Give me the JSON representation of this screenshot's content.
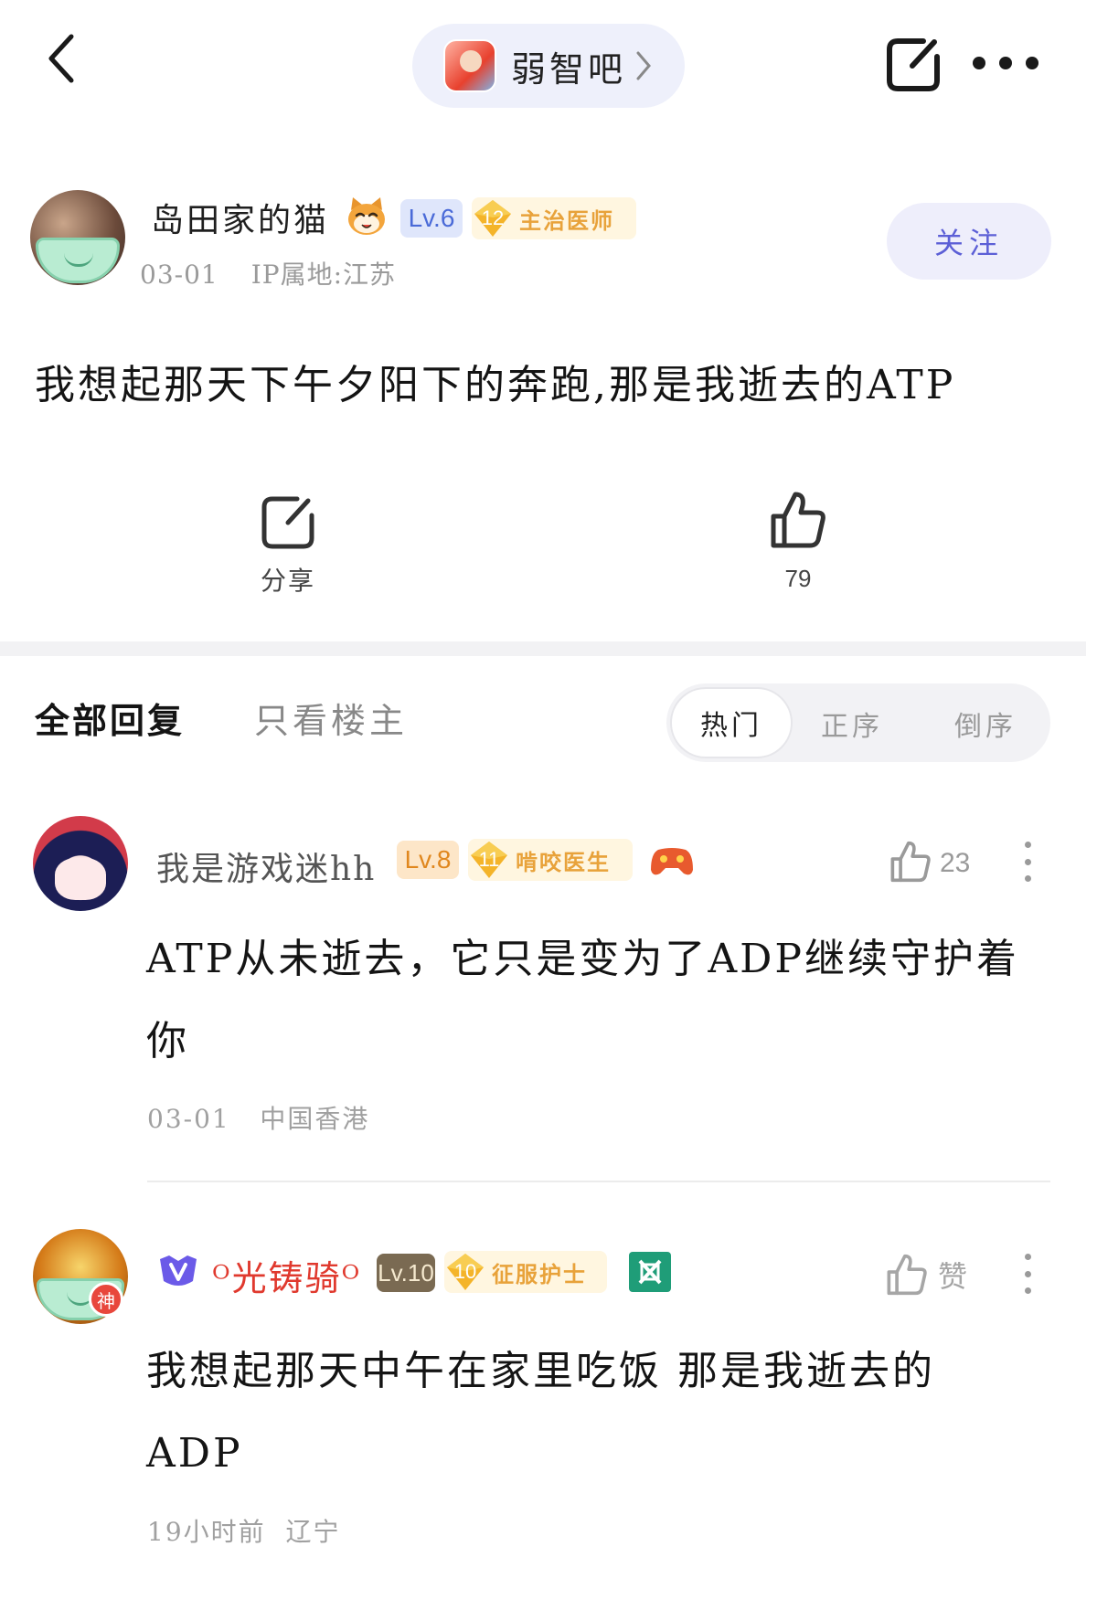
{
  "header": {
    "forum_name": "弱智吧"
  },
  "post": {
    "author": {
      "name": "岛田家的猫",
      "level": "Lv.6",
      "title_level": "12",
      "title": "主治医师",
      "date": "03-01",
      "ip": "IP属地:江苏"
    },
    "follow_label": "关注",
    "content": "我想起那天下午夕阳下的奔跑,那是我逝去的ATP",
    "share_label": "分享",
    "like_count": "79"
  },
  "tabs": {
    "all": "全部回复",
    "op_only": "只看楼主",
    "sort": [
      "热门",
      "正序",
      "倒序"
    ]
  },
  "replies": [
    {
      "name": "我是游戏迷hh",
      "level": "Lv.8",
      "title_level": "11",
      "title": "啃咬医生",
      "likes": "23",
      "content": "ATP从未逝去，它只是变为了ADP继续守护着你",
      "date": "03-01",
      "location": "中国香港"
    },
    {
      "name": "ᴼ光铸骑ᴼ",
      "level": "Lv.10",
      "title_level": "10",
      "title": "征服护士",
      "like_label": "赞",
      "avatar_tag": "神",
      "content": "我想起那天中午在家里吃饭 那是我逝去的ADP",
      "time": "19小时前",
      "location": "辽宁"
    }
  ],
  "colors": {
    "accent": "#5c5fd6",
    "level_blue": "#4a6ad8",
    "title_gold": "#e8a23a",
    "vip_red": "#e0392e"
  }
}
